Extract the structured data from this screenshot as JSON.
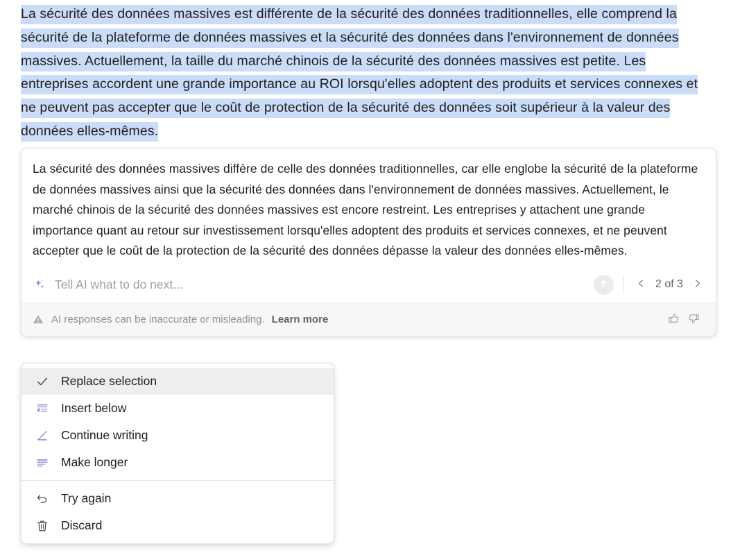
{
  "document": {
    "selected_text": "La sécurité des données massives est différente de la sécurité des données traditionnelles, elle comprend la sécurité de la plateforme de données massives et la sécurité des données dans l'environnement de données massives. Actuellement, la taille du marché chinois de la sécurité des données massives est petite. Les entreprises accordent une grande importance au ROI lorsqu'elles adoptent des produits et services connexes et ne peuvent pas accepter que le coût de protection de la sécurité des données soit supérieur à la valeur des données elles-mêmes.",
    "selection_highlight_color": "#cbdcf8"
  },
  "ai_card": {
    "response_text": "La sécurité des données massives diffère de celle des données traditionnelles, car elle englobe la sécurité de la plateforme de données massives ainsi que la sécurité des données dans l'environnement de données massives. Actuellement, le marché chinois de la sécurité des données massives est encore restreint. Les entreprises y attachent une grande importance quant au retour sur investissement lorsqu'elles adoptent des produits et services connexes, et ne peuvent accepter que le coût de la protection de la sécurité des données dépasse la valeur des données elles-mêmes.",
    "prompt": {
      "icon": "sparkle-icon",
      "placeholder": "Tell AI what to do next...",
      "value": "",
      "accent_color": "#9b7fd4"
    },
    "submit": {
      "icon": "arrow-up-icon",
      "label": "Submit",
      "background_color": "#ececec",
      "enabled": false
    },
    "pagination": {
      "prev_icon": "chevron-left-icon",
      "next_icon": "chevron-right-icon",
      "label": "2 of 3",
      "current": 2,
      "total": 3
    },
    "disclaimer": {
      "icon": "warning-triangle-icon",
      "text": "AI responses can be inaccurate or misleading.",
      "link_label": "Learn more"
    },
    "feedback": {
      "up_icon": "thumbs-up-icon",
      "up_label": "Good response",
      "down_icon": "thumbs-down-icon",
      "down_label": "Bad response"
    }
  },
  "menu": {
    "groups": [
      {
        "items": [
          {
            "icon": "check-icon",
            "label": "Replace selection",
            "selected": true
          },
          {
            "icon": "insert-below-icon",
            "label": "Insert below",
            "selected": false
          },
          {
            "icon": "continue-writing-icon",
            "label": "Continue writing",
            "selected": false
          },
          {
            "icon": "make-longer-icon",
            "label": "Make longer",
            "selected": false
          }
        ]
      },
      {
        "items": [
          {
            "icon": "undo-arrow-icon",
            "label": "Try again",
            "selected": false
          },
          {
            "icon": "trash-icon",
            "label": "Discard",
            "selected": false
          }
        ]
      }
    ],
    "icon_accent_color": "#8f74c9"
  }
}
